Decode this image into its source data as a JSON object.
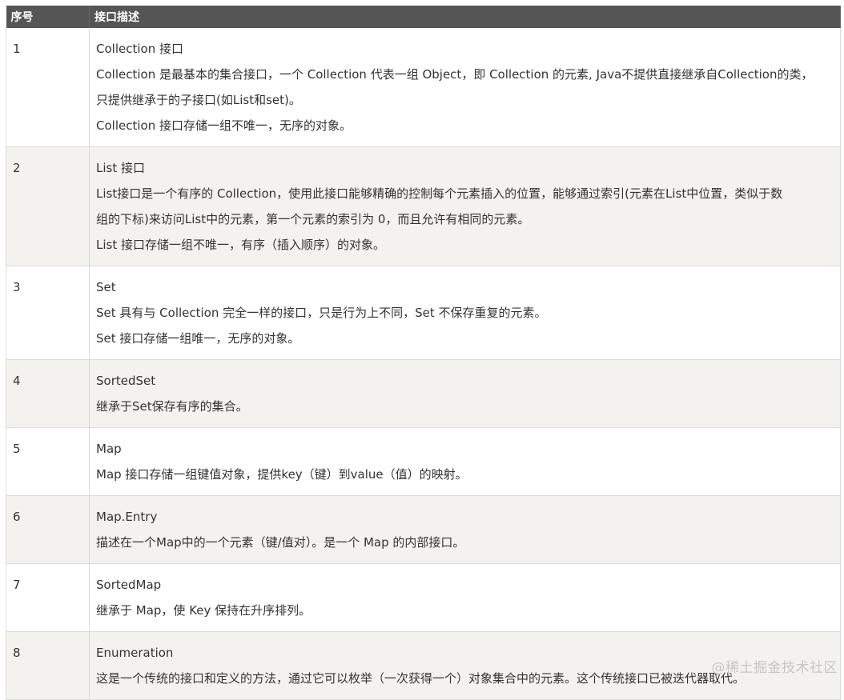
{
  "header": {
    "col_no": "序号",
    "col_desc": "接口描述"
  },
  "rows": [
    {
      "no": "1",
      "title": "Collection 接口",
      "lines": [
        "Collection 是最基本的集合接口，一个 Collection 代表一组 Object，即 Collection 的元素, Java不提供直接继承自Collection的类，",
        "只提供继承于的子接口(如List和set)。",
        "Collection 接口存储一组不唯一，无序的对象。"
      ]
    },
    {
      "no": "2",
      "title": "List 接口",
      "lines": [
        "List接口是一个有序的 Collection，使用此接口能够精确的控制每个元素插入的位置，能够通过索引(元素在List中位置，类似于数",
        "组的下标)来访问List中的元素，第一个元素的索引为 0，而且允许有相同的元素。",
        "List 接口存储一组不唯一，有序（插入顺序）的对象。"
      ]
    },
    {
      "no": "3",
      "title": "Set",
      "lines": [
        "Set 具有与 Collection 完全一样的接口，只是行为上不同，Set 不保存重复的元素。",
        "Set 接口存储一组唯一，无序的对象。"
      ]
    },
    {
      "no": "4",
      "title": "SortedSet",
      "lines": [
        "继承于Set保存有序的集合。"
      ]
    },
    {
      "no": "5",
      "title": "Map",
      "lines": [
        "Map 接口存储一组键值对象，提供key（键）到value（值）的映射。"
      ]
    },
    {
      "no": "6",
      "title": "Map.Entry",
      "lines": [
        "描述在一个Map中的一个元素（键/值对）。是一个 Map 的内部接口。"
      ]
    },
    {
      "no": "7",
      "title": "SortedMap",
      "lines": [
        "继承于 Map，使 Key 保持在升序排列。"
      ]
    },
    {
      "no": "8",
      "title": "Enumeration",
      "lines": [
        "这是一个传统的接口和定义的方法，通过它可以枚举（一次获得一个）对象集合中的元素。这个传统接口已被迭代器取代。"
      ]
    }
  ],
  "watermark": "@稀土掘金技术社区",
  "colors": {
    "header_bg": "#555555",
    "header_text": "#ffffff",
    "row_alt_bg": "#f3f2ee",
    "border": "#dcdcdc",
    "text": "#333333"
  }
}
